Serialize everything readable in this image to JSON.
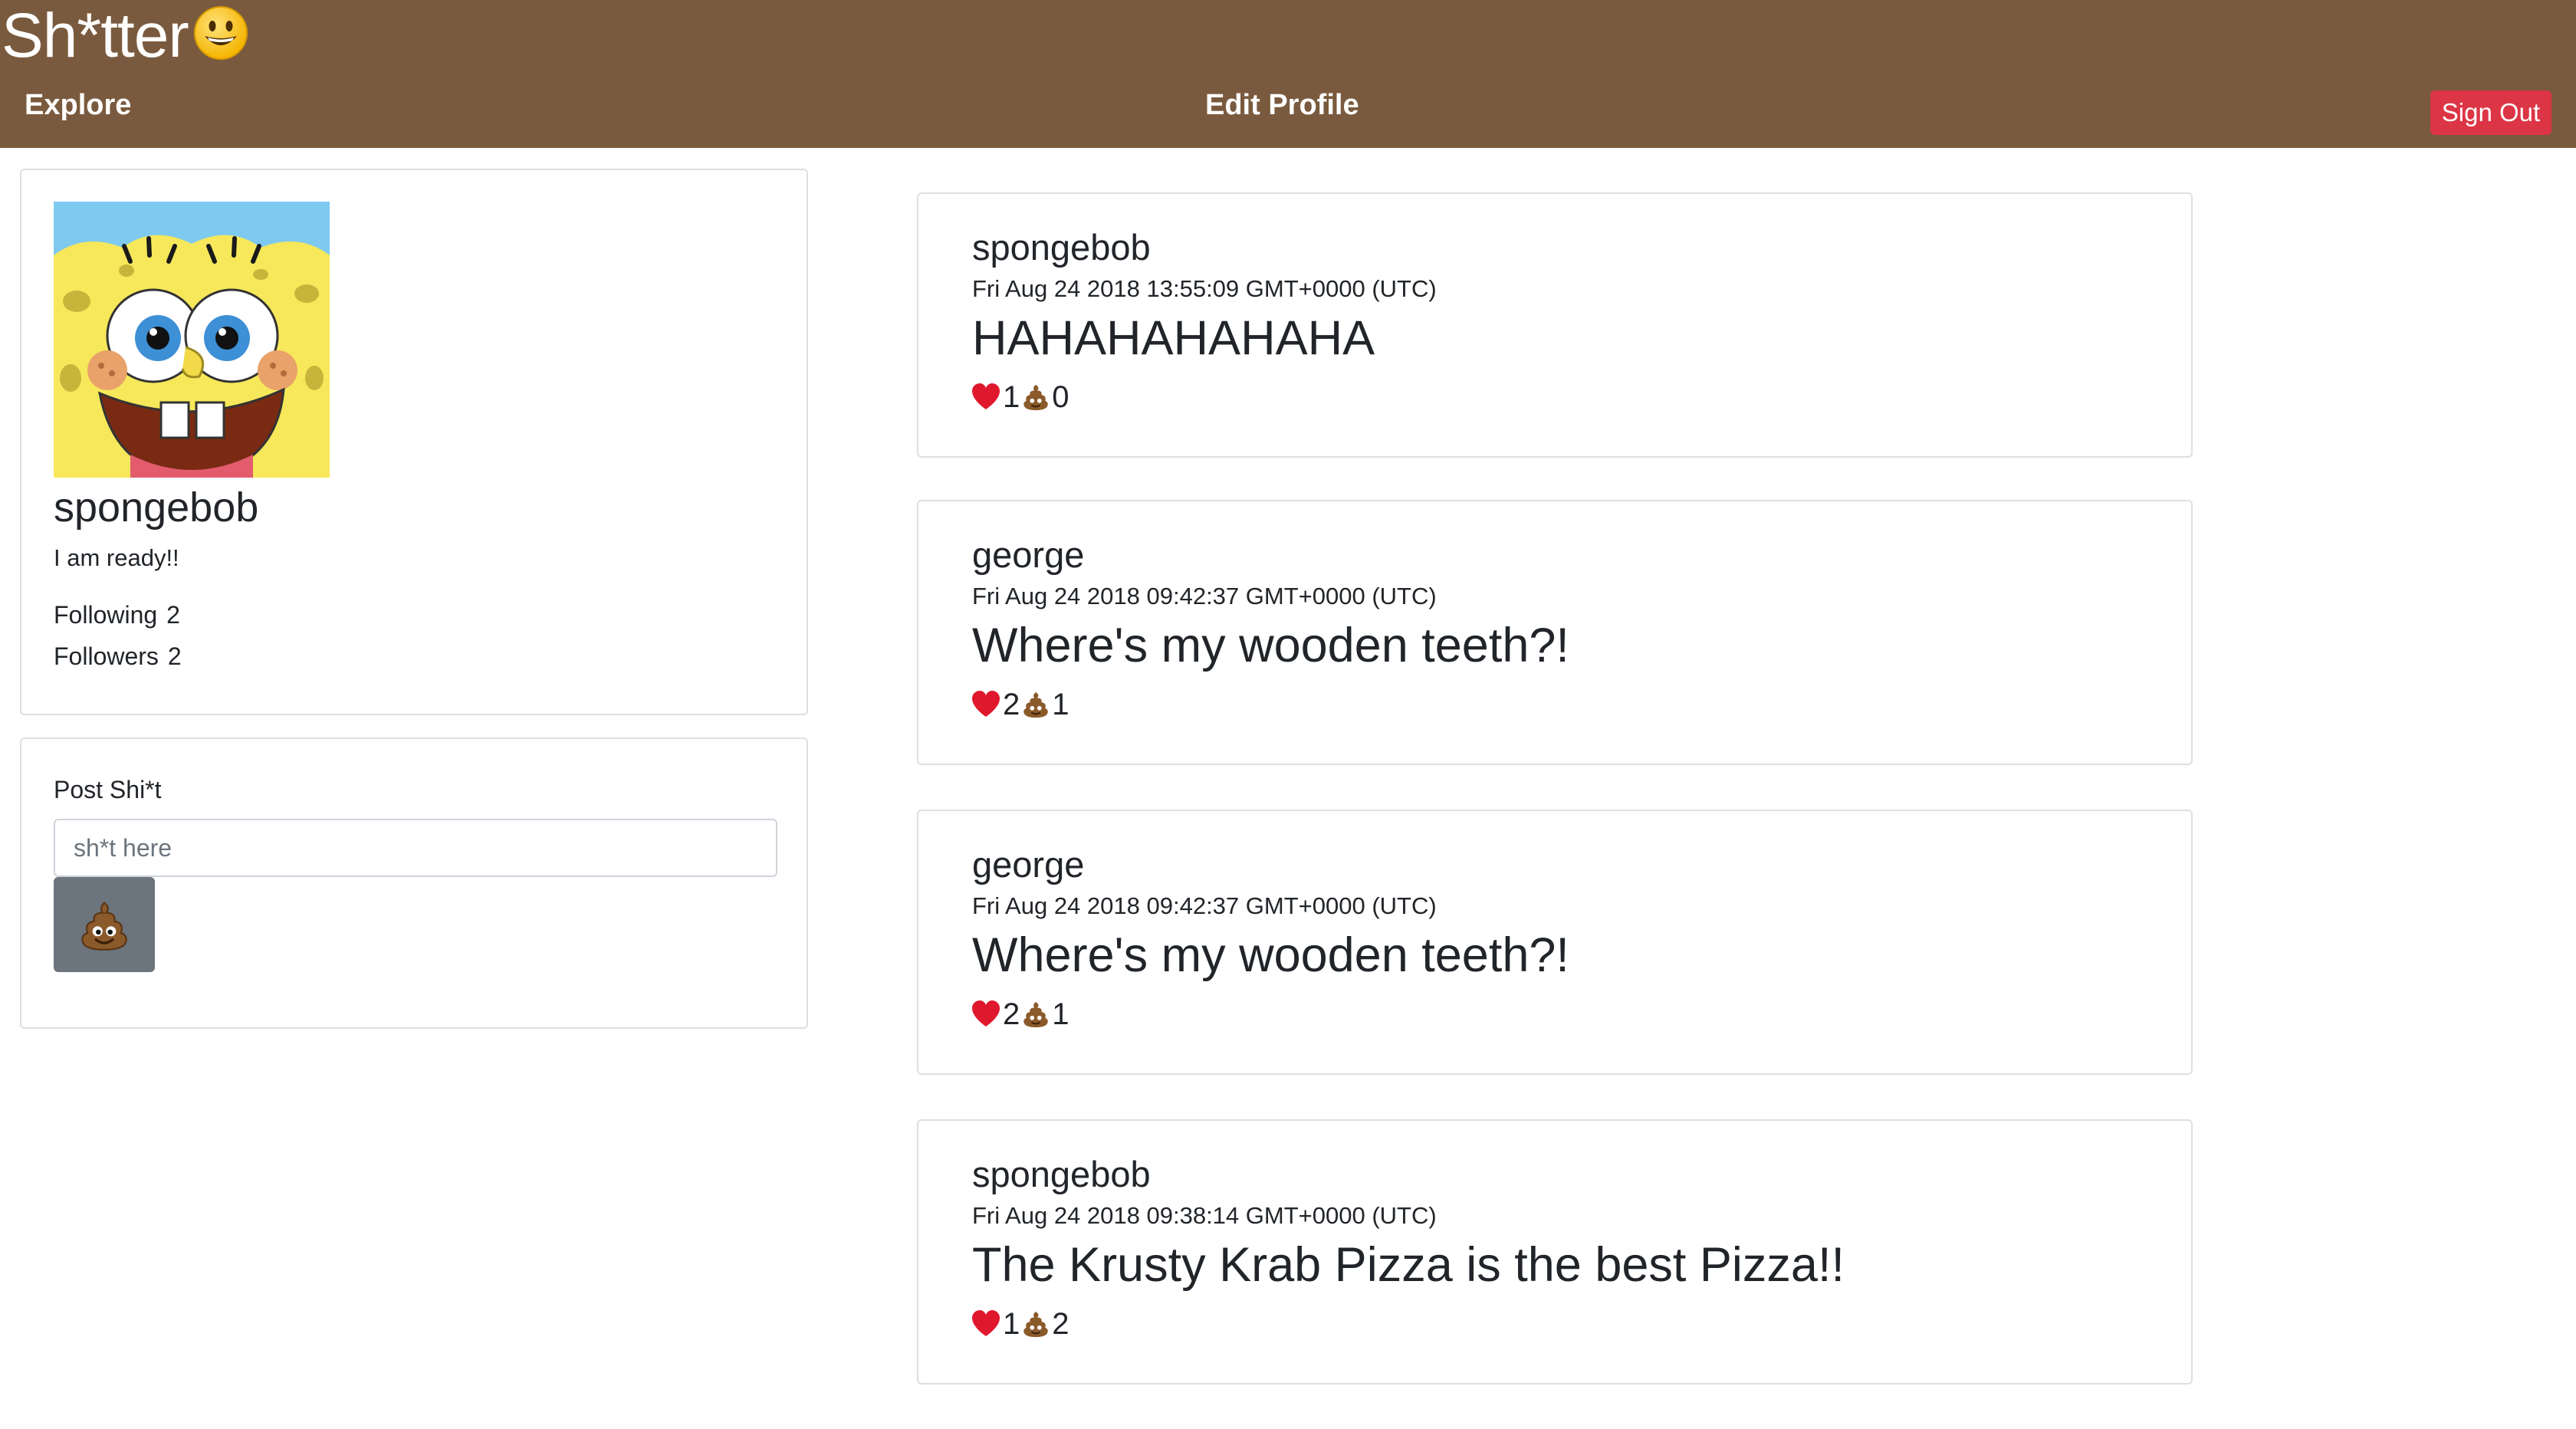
{
  "header": {
    "brand": "Sh*tter",
    "brand_icon": "smiley-icon",
    "explore_label": "Explore",
    "edit_profile_label": "Edit Profile",
    "sign_out_label": "Sign Out"
  },
  "profile": {
    "username": "spongebob",
    "bio": "I am ready!!",
    "following_label": "Following",
    "following_count": "2",
    "followers_label": "Followers",
    "followers_count": "2"
  },
  "composer": {
    "label": "Post Shi*t",
    "placeholder": "sh*t here",
    "submit_icon": "poop-icon"
  },
  "feed": [
    {
      "user": "spongebob",
      "time": "Fri Aug 24 2018 13:55:09 GMT+0000 (UTC)",
      "body": "HAHAHAHAHAHA",
      "likes": "1",
      "poops": "0"
    },
    {
      "user": "george",
      "time": "Fri Aug 24 2018 09:42:37 GMT+0000 (UTC)",
      "body": "Where's my wooden teeth?!",
      "likes": "2",
      "poops": "1"
    },
    {
      "user": "george",
      "time": "Fri Aug 24 2018 09:42:37 GMT+0000 (UTC)",
      "body": "Where's my wooden teeth?!",
      "likes": "2",
      "poops": "1"
    },
    {
      "user": "spongebob",
      "time": "Fri Aug 24 2018 09:38:14 GMT+0000 (UTC)",
      "body": "The Krusty Krab Pizza is the best Pizza!!",
      "likes": "1",
      "poops": "2"
    }
  ],
  "colors": {
    "navbar": "#7a5a3e",
    "danger": "#dc3545",
    "secondary": "#6c757d",
    "heart": "#e0182d",
    "poop": "#8b5a2b"
  }
}
